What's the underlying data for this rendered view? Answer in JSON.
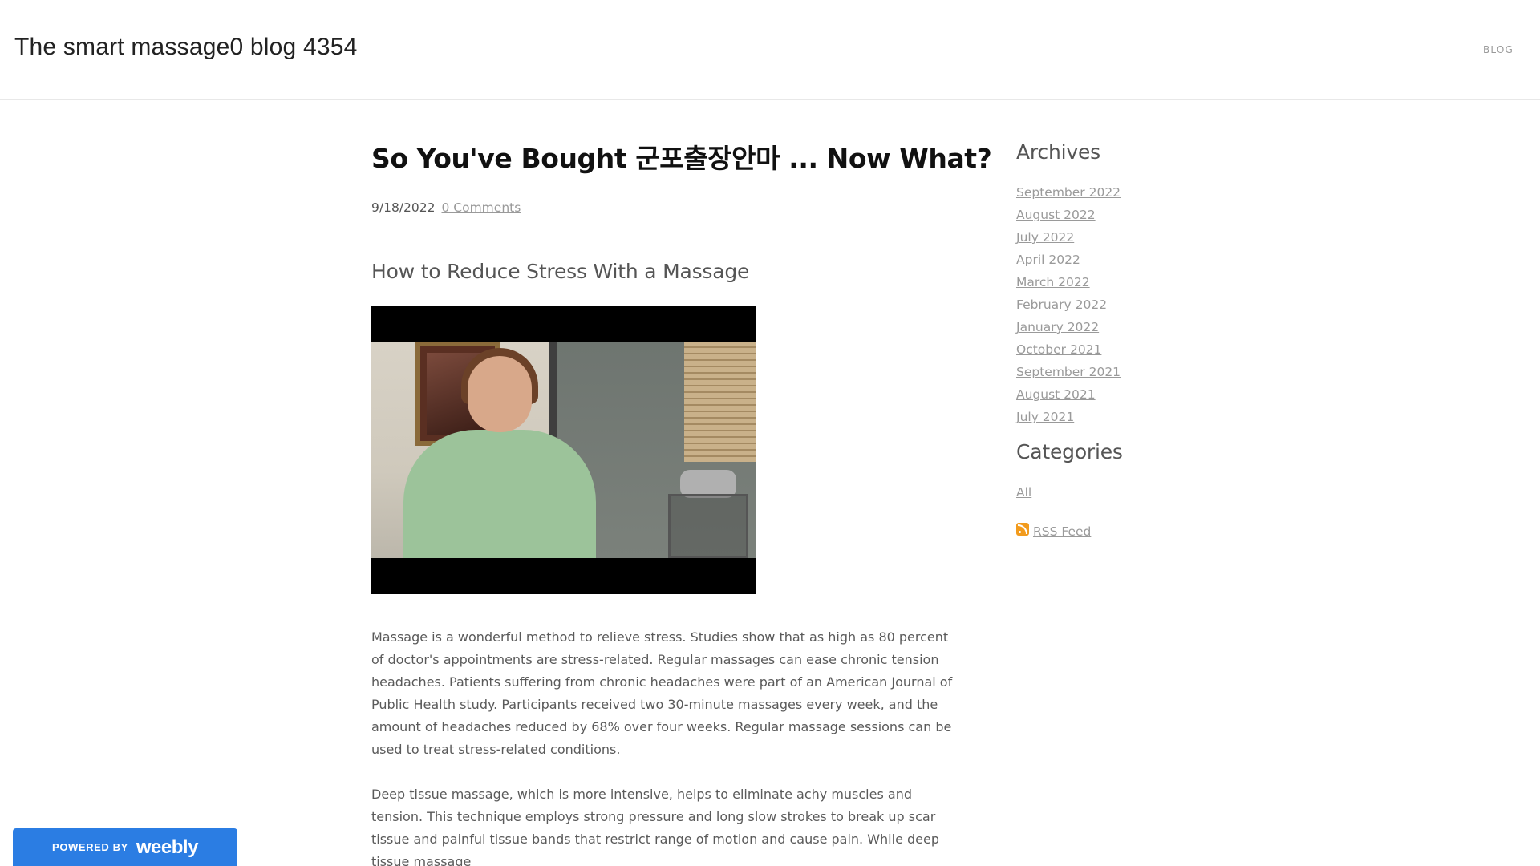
{
  "header": {
    "site_title": "The smart massage0 blog 4354",
    "nav": [
      {
        "label": "BLOG"
      }
    ]
  },
  "post": {
    "title": "So You've Bought 군포출장안마 ... Now What?",
    "date": "9/18/2022",
    "comments_link": "0 Comments",
    "section_heading": "How to Reduce Stress With a Massage",
    "paragraphs": [
      "Massage is a wonderful method to relieve stress. Studies show that as high as 80 percent of doctor's appointments are stress-related. Regular massages can ease chronic tension headaches. Patients suffering from chronic headaches were part of an American Journal of Public Health study. Participants received two 30-minute massages every week, and the amount of headaches reduced by 68% over four weeks. Regular massage sessions can be used to treat stress-related conditions.",
      "Deep tissue massage, which is more intensive, helps to eliminate achy muscles and tension. This technique employs strong pressure and long slow strokes to break up scar tissue and painful tissue bands that restrict range of motion and cause pain. While deep tissue massage"
    ]
  },
  "sidebar": {
    "archives_title": "Archives",
    "archives": [
      "September 2022",
      "August 2022",
      "July 2022",
      "April 2022",
      "March 2022",
      "February 2022",
      "January 2022",
      "October 2021",
      "September 2021",
      "August 2021",
      "July 2021"
    ],
    "categories_title": "Categories",
    "categories": [
      "All"
    ],
    "rss_label": "RSS Feed",
    "rss_icon": "rss-icon"
  },
  "badge": {
    "powered_by": "POWERED BY",
    "brand": "weebly",
    "color": "#2b7de3"
  }
}
